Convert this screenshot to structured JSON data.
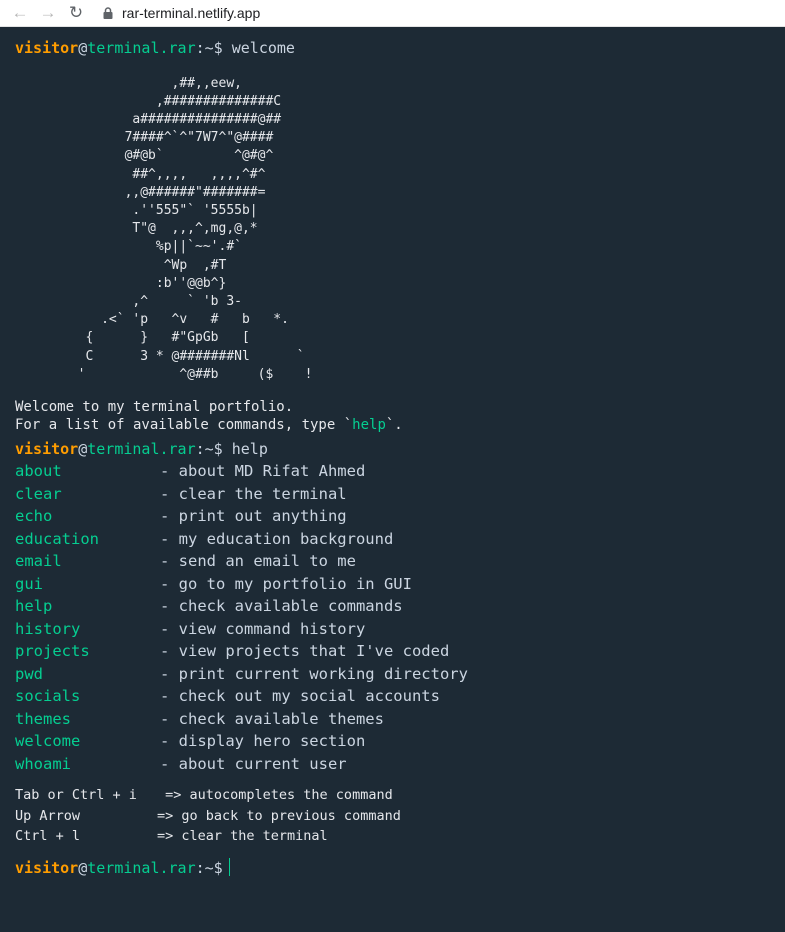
{
  "browser": {
    "url": "rar-terminal.netlify.app",
    "back_icon": "arrow-left-icon",
    "forward_icon": "arrow-right-icon",
    "reload_icon": "reload-icon",
    "lock_icon": "lock-icon"
  },
  "prompt": {
    "user": "visitor",
    "at": "@",
    "host": "terminal.rar",
    "path": ":~$"
  },
  "history": [
    {
      "command": "welcome"
    },
    {
      "command": "help"
    }
  ],
  "ascii_art": "                    ,##,,eew,\n                  ,##############C\n               a###############@##\n              7####^`^\"7W7^\"@####\n              @#@b`         ^@#@^\n               ##^,,,,   ,,,,^#^\n              ,,@######\"#######=\n               .''555\"` '5555b|\n               T\"@  ,,,^,mg,@,*\n                  %p||`~~'.#`\n                   ^Wp  ,#T\n                  :b''@@b^}\n               ,^     ` 'b 3-\n           .<` 'p   ^v   #   b   *.\n         {      }   #\"GpGb   [\n         C      3 * @#######Nl      `\n        '            ^@##b     ($    !",
  "welcome": {
    "line1": "Welcome to my terminal portfolio.",
    "line2_pre": "For a list of available commands, type `",
    "line2_hl": "help",
    "line2_post": "`."
  },
  "help_commands": [
    {
      "cmd": "about",
      "desc": "- about MD Rifat Ahmed"
    },
    {
      "cmd": "clear",
      "desc": "- clear the terminal"
    },
    {
      "cmd": "echo",
      "desc": "- print out anything"
    },
    {
      "cmd": "education",
      "desc": "- my education background"
    },
    {
      "cmd": "email",
      "desc": "- send an email to me"
    },
    {
      "cmd": "gui",
      "desc": "- go to my portfolio in GUI"
    },
    {
      "cmd": "help",
      "desc": "- check available commands"
    },
    {
      "cmd": "history",
      "desc": "- view command history"
    },
    {
      "cmd": "projects",
      "desc": "- view projects that I've coded"
    },
    {
      "cmd": "pwd",
      "desc": "- print current working directory"
    },
    {
      "cmd": "socials",
      "desc": "- check out my social accounts"
    },
    {
      "cmd": "themes",
      "desc": "- check available themes"
    },
    {
      "cmd": "welcome",
      "desc": "- display hero section"
    },
    {
      "cmd": "whoami",
      "desc": "- about current user"
    }
  ],
  "shortcuts": [
    {
      "key": "Tab or Ctrl + i",
      "desc": " => autocompletes the command"
    },
    {
      "key": "Up Arrow",
      "desc": "=> go back to previous command"
    },
    {
      "key": "Ctrl + l",
      "desc": "=> clear the terminal"
    }
  ],
  "input": {
    "value": ""
  },
  "colors": {
    "background": "#1d2a35",
    "user": "#ff9d00",
    "host": "#05ce91",
    "text": "#cbd5e1"
  }
}
